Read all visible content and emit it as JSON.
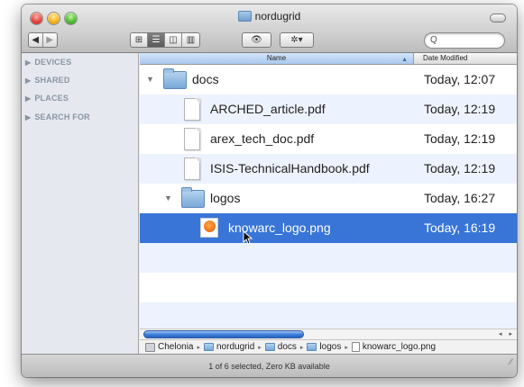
{
  "window": {
    "title": "nordugrid"
  },
  "toolbar": {
    "back": "◀",
    "forward": "▶",
    "view_icon": "⊞",
    "view_list": "☰",
    "view_column": "◫",
    "view_coverflow": "▥",
    "quicklook": "👁",
    "action": "✲▾",
    "search_placeholder": "Q"
  },
  "sidebar": {
    "items": [
      "DEVICES",
      "SHARED",
      "PLACES",
      "SEARCH FOR"
    ]
  },
  "columns": {
    "name": "Name",
    "date": "Date Modified"
  },
  "rows": [
    {
      "name": "docs",
      "date": "Today, 12:07",
      "kind": "folder",
      "disclosure": "▼"
    },
    {
      "name": "ARCHED_article.pdf",
      "date": "Today, 12:19",
      "kind": "doc"
    },
    {
      "name": "arex_tech_doc.pdf",
      "date": "Today, 12:19",
      "kind": "doc"
    },
    {
      "name": "ISIS-TechnicalHandbook.pdf",
      "date": "Today, 12:19",
      "kind": "doc"
    },
    {
      "name": "logos",
      "date": "Today, 16:27",
      "kind": "folder",
      "disclosure": "▼"
    },
    {
      "name": "knowarc_logo.png",
      "date": "Today, 16:19",
      "kind": "png",
      "selected": true
    }
  ],
  "path": [
    "Chelonia",
    "nordugrid",
    "docs",
    "logos",
    "knowarc_logo.png"
  ],
  "path_separator": "▸",
  "scroll_arrows": "◂ ▸",
  "status": "1 of 6 selected, Zero KB available",
  "colors": {
    "selection": "#3875d7",
    "stripe": "#edf3fe",
    "sidebar": "#e5e9ef"
  }
}
